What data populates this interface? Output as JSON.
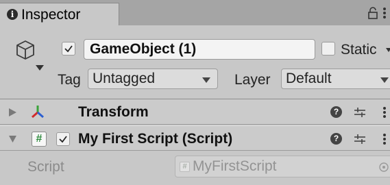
{
  "tab": {
    "icon": "info-icon",
    "icon_glyph": "i",
    "label": "Inspector"
  },
  "header": {
    "active": true,
    "object_name": "GameObject (1)",
    "static_label": "Static",
    "static_checked": false,
    "tag_label": "Tag",
    "tag_value": "Untagged",
    "layer_label": "Layer",
    "layer_value": "Default"
  },
  "components": [
    {
      "name": "Transform",
      "expanded": false,
      "icon": "transform-icon"
    },
    {
      "name": "My First Script (Script)",
      "expanded": true,
      "enabled": true,
      "icon": "script-icon",
      "icon_glyph": "#"
    }
  ],
  "script_property": {
    "label": "Script",
    "value": "MyFirstScript",
    "icon_glyph": "#"
  },
  "help_glyph": "?",
  "colors": {
    "accent_green": "#2c8a3c",
    "transform_red": "#d12b2b",
    "transform_green": "#3aa33a",
    "transform_blue": "#2b5fd1"
  }
}
